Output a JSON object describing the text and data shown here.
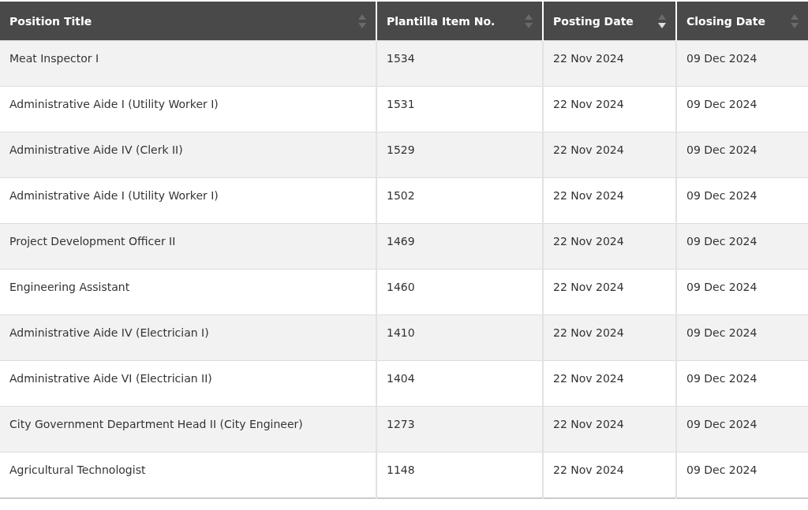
{
  "table": {
    "columns": [
      {
        "label": "Position Title",
        "sorted_descending": false
      },
      {
        "label": "Plantilla Item No.",
        "sorted_descending": false
      },
      {
        "label": "Posting Date",
        "sorted_descending": true
      },
      {
        "label": "Closing Date",
        "sorted_descending": false
      }
    ],
    "rows": [
      [
        "Meat Inspector I",
        "1534",
        "22 Nov 2024",
        "09 Dec 2024"
      ],
      [
        "Administrative Aide I (Utility Worker I)",
        "1531",
        "22 Nov 2024",
        "09 Dec 2024"
      ],
      [
        "Administrative Aide IV (Clerk II)",
        "1529",
        "22 Nov 2024",
        "09 Dec 2024"
      ],
      [
        "Administrative Aide I (Utility Worker I)",
        "1502",
        "22 Nov 2024",
        "09 Dec 2024"
      ],
      [
        "Project Development Officer II",
        "1469",
        "22 Nov 2024",
        "09 Dec 2024"
      ],
      [
        "Engineering Assistant",
        "1460",
        "22 Nov 2024",
        "09 Dec 2024"
      ],
      [
        "Administrative Aide IV (Electrician I)",
        "1410",
        "22 Nov 2024",
        "09 Dec 2024"
      ],
      [
        "Administrative Aide VI (Electrician II)",
        "1404",
        "22 Nov 2024",
        "09 Dec 2024"
      ],
      [
        "City Government Department Head II (City Engineer)",
        "1273",
        "22 Nov 2024",
        "09 Dec 2024"
      ],
      [
        "Agricultural Technologist",
        "1148",
        "22 Nov 2024",
        "09 Dec 2024"
      ]
    ]
  }
}
